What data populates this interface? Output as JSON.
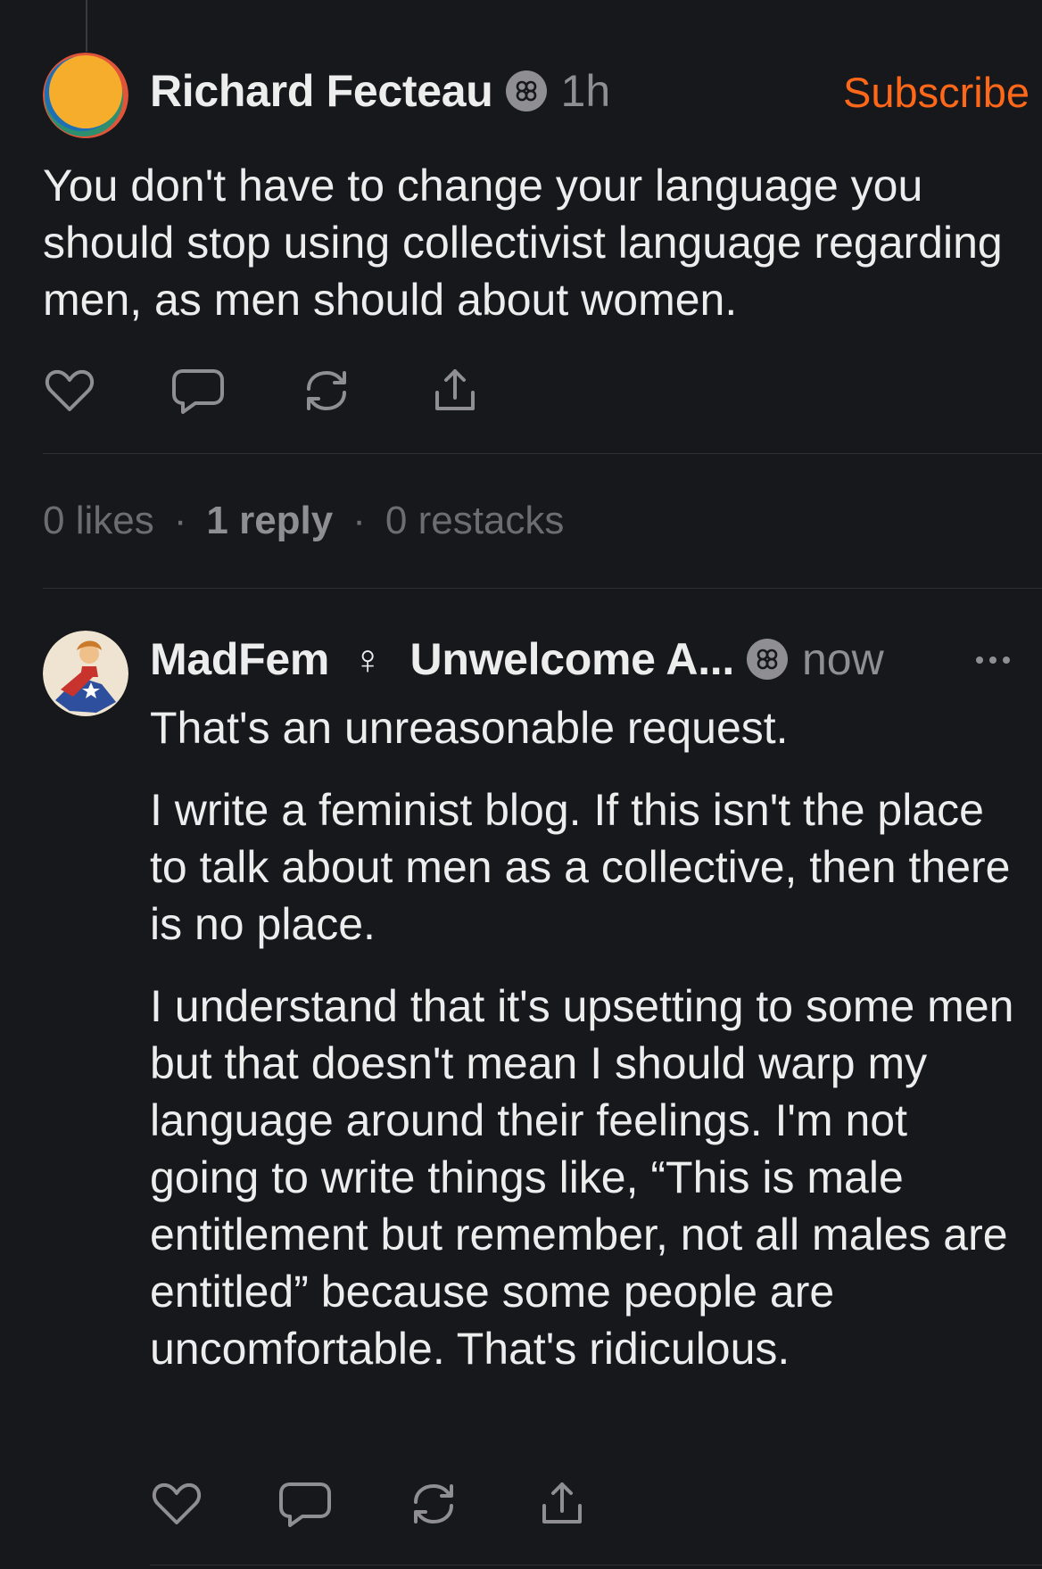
{
  "post": {
    "author": "Richard Fecteau",
    "time": "1h",
    "subscribe_label": "Subscribe",
    "body": "You don't have to change your language you should stop using collectivist language regarding men, as men should about women.",
    "stats": {
      "likes": "0 likes",
      "separator": "·",
      "replies": "1 reply",
      "restacks": "0 restacks"
    },
    "actions": [
      "heart-icon",
      "comment-icon",
      "restack-icon",
      "share-icon"
    ]
  },
  "reply": {
    "author": "MadFem",
    "gender_symbol": "♀",
    "publication": "Unwelcome A...",
    "time": "now",
    "paragraphs": [
      "That's an unreasonable request.",
      "I write a feminist blog. If this isn't the place to talk about men as a collective, then there is no place.",
      "I understand that it's upsetting to some men but that doesn't mean I should warp my language around their feelings. I'm not going to write things like, “This is male entitlement but remember, not all males are entitled” because some people are uncomfortable. That's ridiculous."
    ],
    "actions": [
      "heart-icon",
      "comment-icon",
      "restack-icon",
      "share-icon"
    ]
  },
  "colors": {
    "background": "#17181b",
    "accent": "#ff6719",
    "muted": "#8e8e93",
    "text": "#ededee"
  }
}
